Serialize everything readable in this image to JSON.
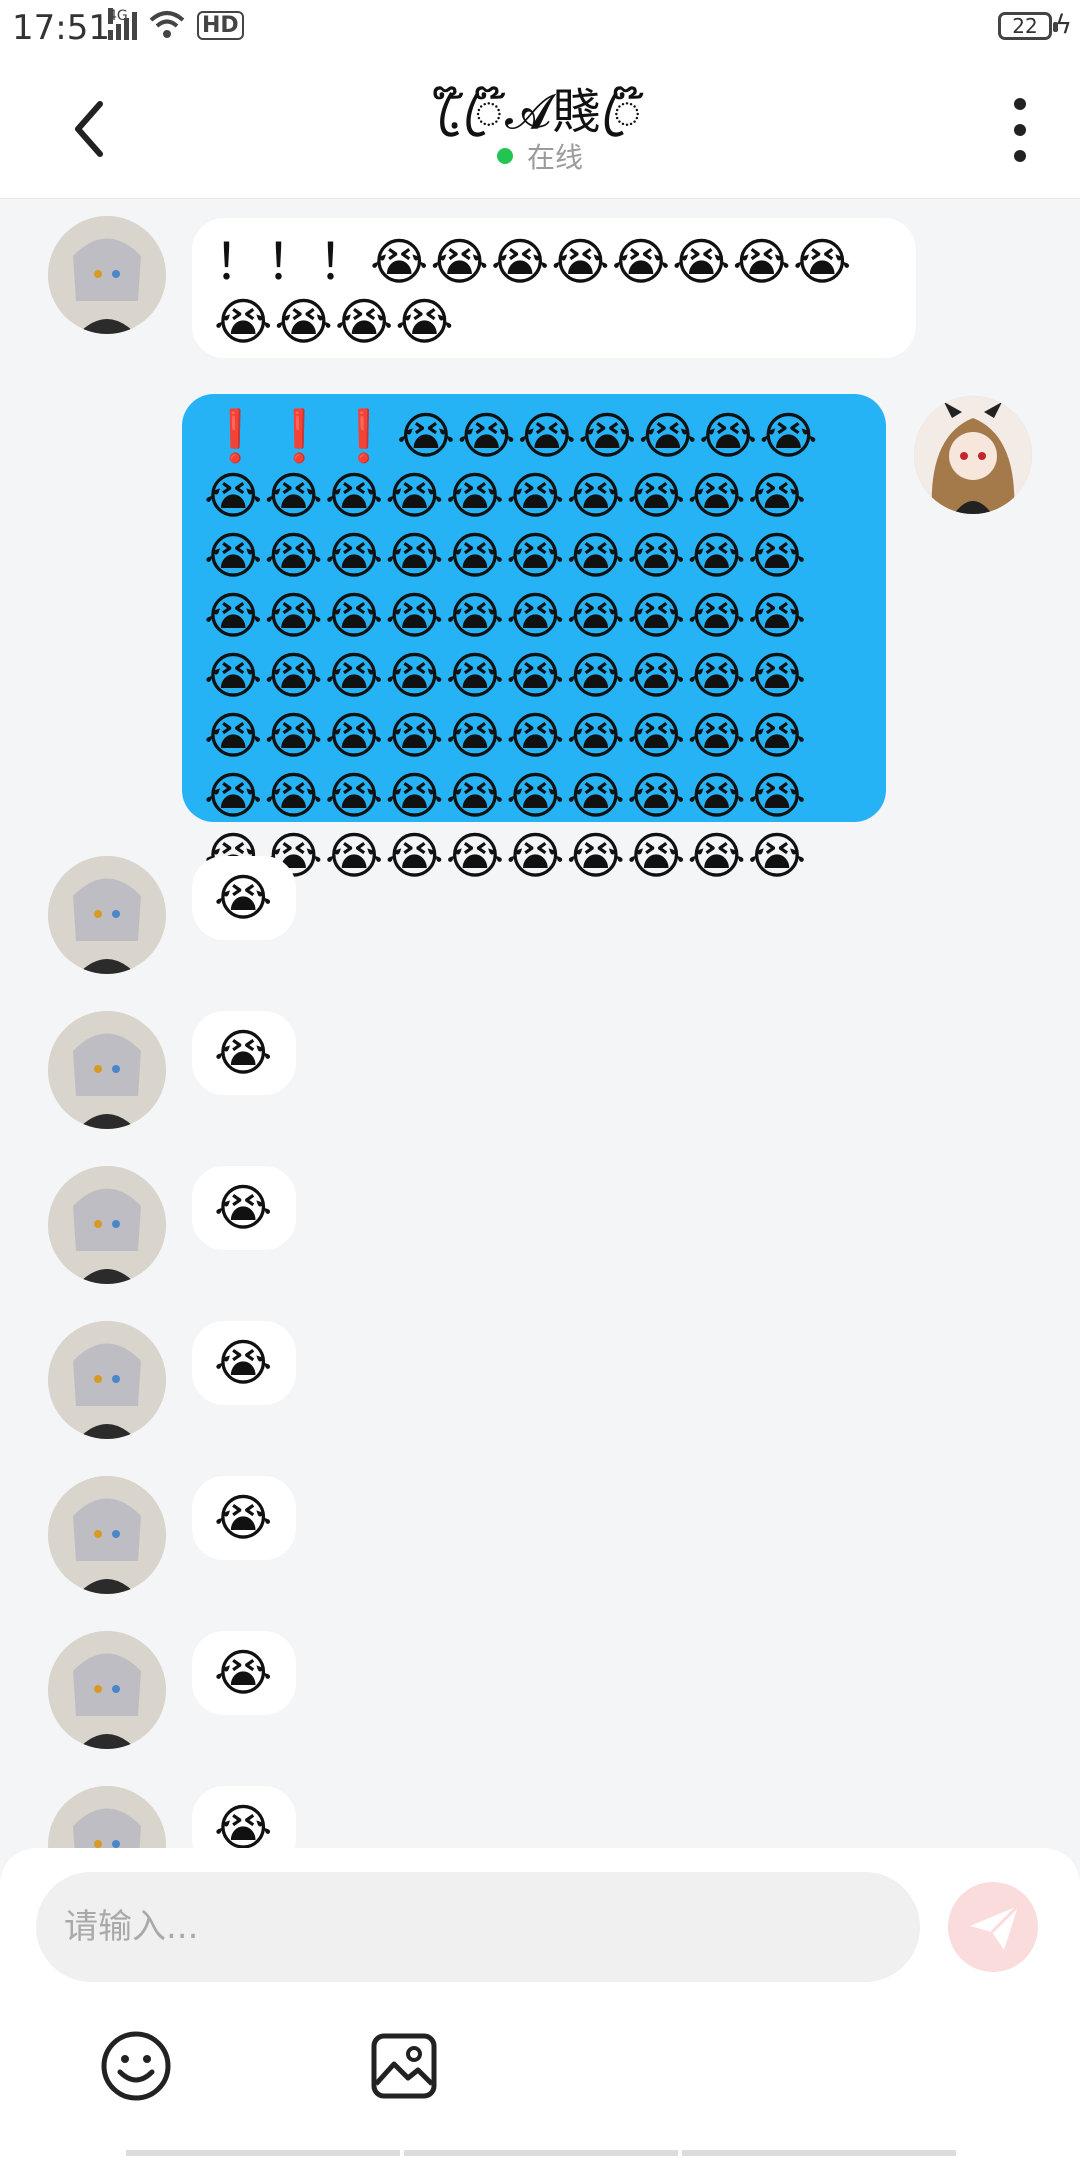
{
  "status_bar": {
    "time": "17:51",
    "network": "4G",
    "hd": "HD",
    "battery": "22"
  },
  "header": {
    "title": ".ꦿ໊ꦿ໊𝓐賤ꦿ໊",
    "status": "在线"
  },
  "messages": [
    {
      "side": "left",
      "text": "！！！😭😭😭😭😭😭😭😭😭😭😭😭"
    },
    {
      "side": "right",
      "text": "❗❗❗😭😭😭😭😭😭😭😭😭😭😭😭😭😭😭😭😭😭😭😭😭😭😭😭😭😭😭😭😭😭😭😭😭😭😭😭😭😭😭😭😭😭😭😭😭😭😭😭😭😭😭😭😭😭😭😭😭😭😭😭😭😭😭😭😭😭😭😭😭😭😭😭😭😭😭😭😭😭"
    },
    {
      "side": "left",
      "text": "😭"
    },
    {
      "side": "left",
      "text": "😭"
    },
    {
      "side": "left",
      "text": "😭"
    },
    {
      "side": "left",
      "text": "😭"
    },
    {
      "side": "left",
      "text": "😭"
    },
    {
      "side": "left",
      "text": "😭"
    },
    {
      "side": "left",
      "text": "😭"
    }
  ],
  "input": {
    "placeholder": "请输入..."
  },
  "icons": {
    "back": "chevron-left-icon",
    "more": "more-vertical-icon",
    "send": "send-icon",
    "emoji": "smiley-icon",
    "image": "image-icon"
  },
  "colors": {
    "outgoing_bubble": "#25b3f6",
    "online_dot": "#23c552",
    "send_button": "#fbdcdc"
  }
}
